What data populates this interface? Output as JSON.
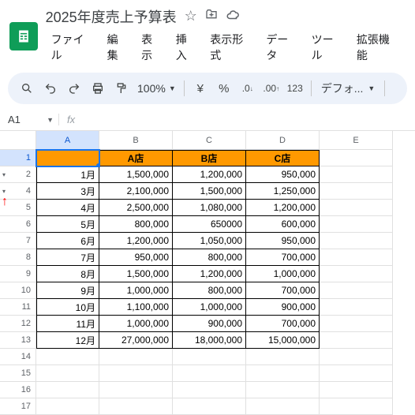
{
  "doc": {
    "title": "2025年度売上予算表"
  },
  "menu": [
    "ファイル",
    "編集",
    "表示",
    "挿入",
    "表示形式",
    "データ",
    "ツール",
    "拡張機能"
  ],
  "toolbar": {
    "zoom": "100%",
    "font": "デフォ..."
  },
  "namebox": "A1",
  "columns": [
    "A",
    "B",
    "C",
    "D",
    "E"
  ],
  "row_numbers": [
    "1",
    "2",
    "4",
    "5",
    "6",
    "7",
    "8",
    "9",
    "10",
    "11",
    "12",
    "13",
    "14",
    "15",
    "16",
    "17"
  ],
  "group_marks": {
    "1": "▾",
    "2": "▾"
  },
  "header_row": [
    "",
    "A店",
    "B店",
    "C店"
  ],
  "data_rows": [
    [
      "1月",
      "1,500,000",
      "1,200,000",
      "950,000"
    ],
    [
      "3月",
      "2,100,000",
      "1,500,000",
      "1,250,000"
    ],
    [
      "4月",
      "2,500,000",
      "1,080,000",
      "1,200,000"
    ],
    [
      "5月",
      "800,000",
      "650000",
      "600,000"
    ],
    [
      "6月",
      "1,200,000",
      "1,050,000",
      "950,000"
    ],
    [
      "7月",
      "950,000",
      "800,000",
      "700,000"
    ],
    [
      "8月",
      "1,500,000",
      "1,200,000",
      "1,000,000"
    ],
    [
      "9月",
      "1,000,000",
      "800,000",
      "700,000"
    ],
    [
      "10月",
      "1,100,000",
      "1,000,000",
      "900,000"
    ],
    [
      "11月",
      "1,000,000",
      "900,000",
      "700,000"
    ],
    [
      "12月",
      "27,000,000",
      "18,000,000",
      "15,000,000"
    ]
  ]
}
